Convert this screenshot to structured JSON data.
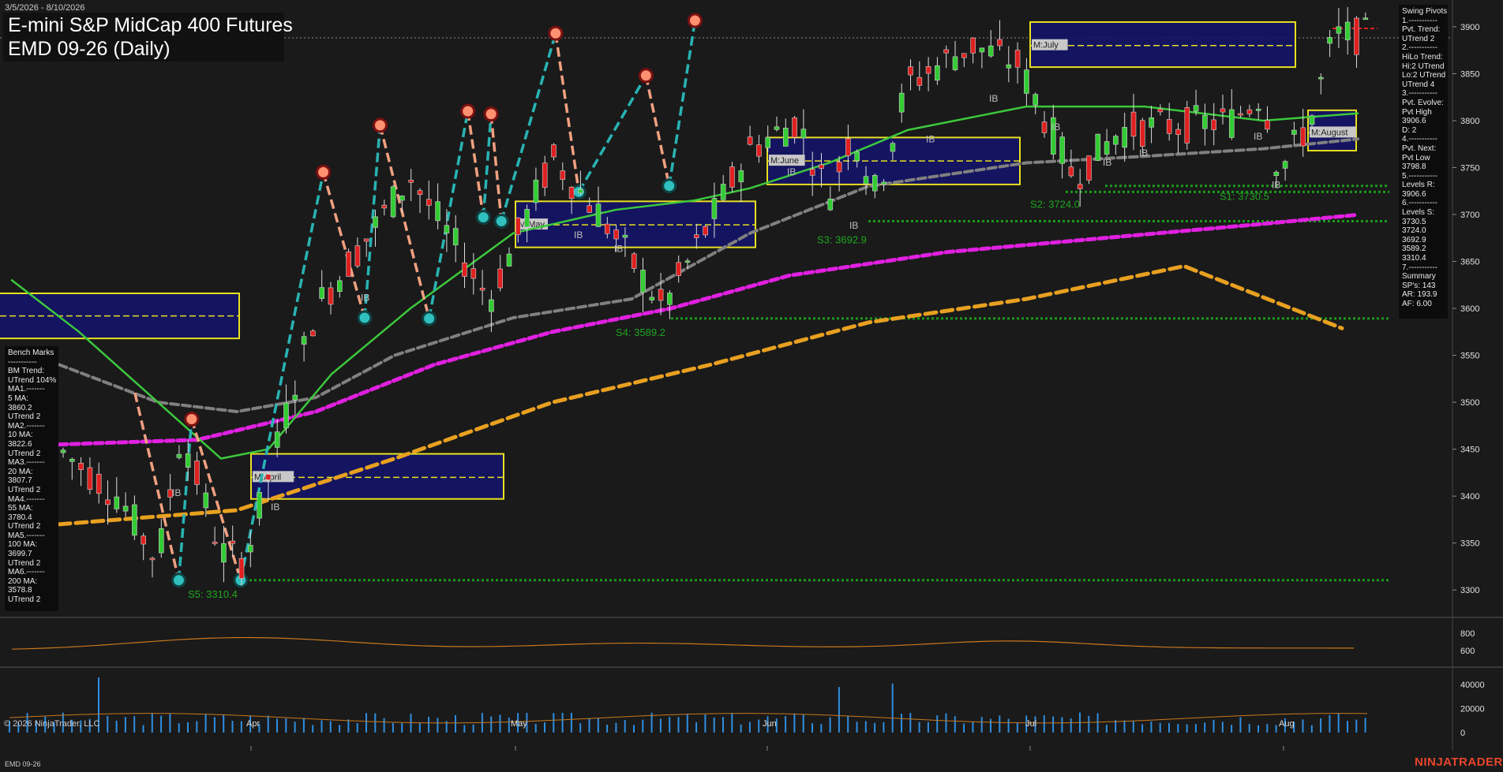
{
  "header": {
    "date_range": "3/5/2026 - 8/10/2026",
    "title_line1": "E-mini S&P MidCap 400 Futures",
    "title_line2": "EMD 09-26 (Daily)"
  },
  "swing_pivots": {
    "text": "Swing Pivots\n1.-----------\nPvt. Trend:\nUTrend 2\n2.-----------\nHiLo Trend:\nHi:2 UTrend\nLo:2 UTrend\nUTrend 4\n3.-----------\nPvt. Evolve:\nPvt High\n3906.6\nD: 2\n4.-----------\nPvt. Next:\nPvt Low\n3798.8\n5.-----------\nLevels R:\n3906.6\n6.-----------\nLevels S:\n3730.5\n3724.0\n3692.9\n3589.2\n3310.4\n7.-----------\nSummary\nSP's: 143\nAR: 193.9\nAF: 6.00"
  },
  "bench_marks": {
    "text": "Bench Marks\n-----------\nBM Trend:\nUTrend 104%\nMA1.-------\n5 MA:\n3860.2\nUTrend 2\nMA2.-------\n10 MA:\n3822.6\nUTrend 2\nMA3.-------\n20 MA:\n3807.7\nUTrend 2\nMA4.-------\n55 MA:\n3780.4\nUTrend 2\nMA5.-------\n100 MA:\n3699.7\nUTrend 2\nMA6.-------\n200 MA:\n3578.8\nUTrend 2"
  },
  "footer": {
    "copyright": "© 2026 NinjaTrader, LLC",
    "symbol": "EMD 09-26",
    "brand": "NINJATRADER"
  },
  "colors": {
    "background": "#1a1a1a",
    "bull_candle": "#33cc33",
    "bear_candle": "#e02020",
    "swing_up": "#29b3b3",
    "swing_down": "#f0a080",
    "ma_fast": "#3cc83c",
    "ma_mid": "#808080",
    "ma_100": "#e020e0",
    "ma_200": "#e8a020",
    "support": "#1a9a1a",
    "box_fill": "#14146e",
    "box_border": "#e8e020",
    "volume": "#2e8ee0",
    "oscillator": "#c8781e"
  },
  "chart_data": [
    {
      "type": "candlestick",
      "name": "price",
      "yaxis_ticks": [
        3300,
        3350,
        3400,
        3450,
        3500,
        3550,
        3600,
        3650,
        3700,
        3750,
        3800,
        3850,
        3900
      ],
      "ylim": [
        3280,
        3910
      ],
      "xaxis_labels": [
        "Apr",
        "May",
        "Jun",
        "Jul",
        "Aug"
      ],
      "swing_points": [
        {
          "type": "high",
          "price": 3745,
          "month_pos": 0.28
        },
        {
          "type": "low",
          "price": 3590,
          "month_pos": 0.44
        },
        {
          "type": "high",
          "price": 3795,
          "month_pos": 0.5
        },
        {
          "type": "low",
          "price": 3589.2,
          "month_pos": 0.69
        },
        {
          "type": "high",
          "price": 3810,
          "month_pos": 0.84
        },
        {
          "type": "low",
          "price": 3697,
          "month_pos": 0.9
        },
        {
          "type": "high",
          "price": 3807,
          "month_pos": 0.93
        },
        {
          "type": "low",
          "price": 3692.9,
          "month_pos": 0.97
        },
        {
          "type": "high",
          "price": 3893,
          "month_pos": 1.18
        },
        {
          "type": "low",
          "price": 3724.0,
          "month_pos": 1.27
        },
        {
          "type": "high",
          "price": 3848,
          "month_pos": 1.53
        },
        {
          "type": "low",
          "price": 3730.5,
          "month_pos": 1.62
        },
        {
          "type": "high",
          "price": 3906.6,
          "month_pos": 1.72
        }
      ],
      "support_levels": [
        {
          "label": "S1: 3730.5",
          "value": 3730.5
        },
        {
          "label": "S2: 3724.0",
          "value": 3724.0
        },
        {
          "label": "S3: 3692.9",
          "value": 3692.9
        },
        {
          "label": "S4: 3589.2",
          "value": 3589.2
        },
        {
          "label": "S5: 3310.4",
          "value": 3310.4
        }
      ],
      "resistance_levels": [
        3906.6
      ],
      "monthly_boxes": [
        {
          "label": "M:April",
          "high": 3445,
          "low": 3397,
          "mid": 3420
        },
        {
          "label": "M:May",
          "high": 3714,
          "low": 3665,
          "mid": 3689
        },
        {
          "label": "M:June",
          "high": 3782,
          "low": 3732,
          "mid": 3757
        },
        {
          "label": "M:July",
          "high": 3905,
          "low": 3857,
          "mid": 3880
        },
        {
          "label": "M:August",
          "high": 3811,
          "low": 3768,
          "mid": 3787
        }
      ],
      "moving_averages": [
        {
          "label": "5 MA",
          "value": 3860.2
        },
        {
          "label": "10 MA",
          "value": 3822.6
        },
        {
          "label": "20 MA",
          "value": 3807.7
        },
        {
          "label": "55 MA",
          "value": 3780.4
        },
        {
          "label": "100 MA",
          "value": 3699.7
        },
        {
          "label": "200 MA",
          "value": 3578.8
        }
      ]
    },
    {
      "type": "line",
      "name": "oscillator",
      "yaxis_ticks": [
        600,
        800
      ],
      "ylim": [
        450,
        950
      ]
    },
    {
      "type": "bar",
      "name": "volume",
      "yaxis_ticks": [
        0,
        20000,
        40000
      ],
      "ylim": [
        -2000,
        52000
      ]
    }
  ]
}
